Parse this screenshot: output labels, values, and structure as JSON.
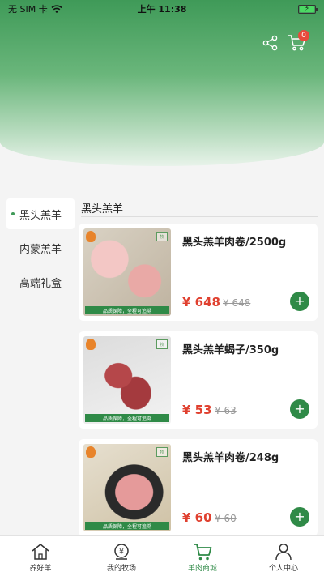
{
  "status": {
    "carrier": "无 SIM 卡",
    "time": "上午 11:38"
  },
  "header": {
    "cart_count": "0"
  },
  "sidebar": {
    "items": [
      {
        "label": "黑头羔羊",
        "active": true
      },
      {
        "label": "内蒙羔羊",
        "active": false
      },
      {
        "label": "高端礼盒",
        "active": false
      }
    ]
  },
  "section": {
    "title": "黑头羔羊"
  },
  "products": [
    {
      "title": "黑头羔羊肉卷/2500g",
      "price": "¥ 648",
      "old_price": "¥ 648",
      "banner": "品质保障，全程可追溯"
    },
    {
      "title": "黑头羔羊蝎子/350g",
      "price": "¥ 53",
      "old_price": "¥ 63",
      "banner": "品质保障，全程可追溯"
    },
    {
      "title": "黑头羔羊肉卷/248g",
      "price": "¥ 60",
      "old_price": "¥ 60",
      "banner": "品质保障，全程可追溯"
    }
  ],
  "tabbar": {
    "items": [
      {
        "label": "养好羊",
        "icon": "home-icon",
        "active": false
      },
      {
        "label": "我的牧场",
        "icon": "ranch-icon",
        "active": false
      },
      {
        "label": "羊肉商城",
        "icon": "cart-icon",
        "active": true
      },
      {
        "label": "个人中心",
        "icon": "person-icon",
        "active": false
      }
    ]
  },
  "colors": {
    "accent": "#2f8a47",
    "price": "#e0402f",
    "badge": "#e84a3c"
  }
}
